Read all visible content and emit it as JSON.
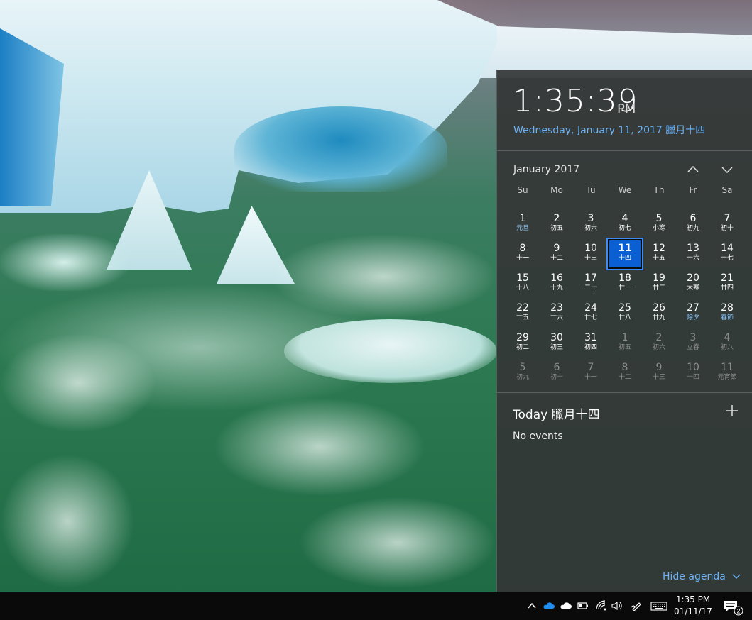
{
  "flyout": {
    "time": "1:35:39",
    "ampm": "PM",
    "date_long": "Wednesday, January 11, 2017 臘月十四",
    "month_label": "January 2017",
    "nav_up_icon": "chevron-up-icon",
    "nav_down_icon": "chevron-down-icon",
    "weekdays": [
      "Su",
      "Mo",
      "Tu",
      "We",
      "Th",
      "Fr",
      "Sa"
    ],
    "weeks": [
      [
        {
          "n": "1",
          "l": "元旦",
          "fest": true
        },
        {
          "n": "2",
          "l": "初五"
        },
        {
          "n": "3",
          "l": "初六"
        },
        {
          "n": "4",
          "l": "初七"
        },
        {
          "n": "5",
          "l": "小寒"
        },
        {
          "n": "6",
          "l": "初九"
        },
        {
          "n": "7",
          "l": "初十"
        }
      ],
      [
        {
          "n": "8",
          "l": "十一"
        },
        {
          "n": "9",
          "l": "十二"
        },
        {
          "n": "10",
          "l": "十三"
        },
        {
          "n": "11",
          "l": "十四",
          "today": true
        },
        {
          "n": "12",
          "l": "十五"
        },
        {
          "n": "13",
          "l": "十六"
        },
        {
          "n": "14",
          "l": "十七"
        }
      ],
      [
        {
          "n": "15",
          "l": "十八"
        },
        {
          "n": "16",
          "l": "十九"
        },
        {
          "n": "17",
          "l": "二十"
        },
        {
          "n": "18",
          "l": "廿一"
        },
        {
          "n": "19",
          "l": "廿二"
        },
        {
          "n": "20",
          "l": "大寒"
        },
        {
          "n": "21",
          "l": "廿四"
        }
      ],
      [
        {
          "n": "22",
          "l": "廿五"
        },
        {
          "n": "23",
          "l": "廿六"
        },
        {
          "n": "24",
          "l": "廿七"
        },
        {
          "n": "25",
          "l": "廿八"
        },
        {
          "n": "26",
          "l": "廿九"
        },
        {
          "n": "27",
          "l": "除夕",
          "fest": true
        },
        {
          "n": "28",
          "l": "春節",
          "fest": true
        }
      ],
      [
        {
          "n": "29",
          "l": "初二"
        },
        {
          "n": "30",
          "l": "初三"
        },
        {
          "n": "31",
          "l": "初四"
        },
        {
          "n": "1",
          "l": "初五",
          "other": true
        },
        {
          "n": "2",
          "l": "初六",
          "other": true
        },
        {
          "n": "3",
          "l": "立春",
          "other": true
        },
        {
          "n": "4",
          "l": "初八",
          "other": true
        }
      ],
      [
        {
          "n": "5",
          "l": "初九",
          "other": true
        },
        {
          "n": "6",
          "l": "初十",
          "other": true
        },
        {
          "n": "7",
          "l": "十一",
          "other": true
        },
        {
          "n": "8",
          "l": "十二",
          "other": true
        },
        {
          "n": "9",
          "l": "十三",
          "other": true
        },
        {
          "n": "10",
          "l": "十四",
          "other": true
        },
        {
          "n": "11",
          "l": "元宵節",
          "other": true
        }
      ]
    ],
    "agenda": {
      "title": "Today 臘月十四",
      "add_icon": "plus-icon",
      "no_events": "No events",
      "hide_label": "Hide agenda"
    },
    "accent_color": "#0a5fd2",
    "link_color": "#6cb3f5"
  },
  "taskbar": {
    "tray_icons": [
      "chevron-up-icon",
      "onedrive-icon",
      "onedrive-icon",
      "battery-icon",
      "wifi-icon",
      "volume-icon",
      "pen-icon",
      "keyboard-icon"
    ],
    "clock_time": "1:35 PM",
    "clock_date": "01/11/17",
    "notification_count": "2",
    "action_center_icon": "notification-icon"
  }
}
